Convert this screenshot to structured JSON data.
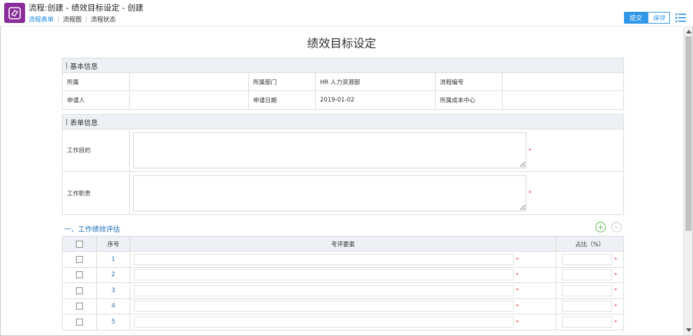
{
  "header": {
    "title": "流程:创建 - 绩效目标设定 - 创建",
    "tabs": [
      {
        "label": "流程表单",
        "active": true
      },
      {
        "label": "流程图",
        "active": false
      },
      {
        "label": "流程状态",
        "active": false
      }
    ],
    "submit_label": "提交",
    "save_label": "保存",
    "logo_icon": "workflow-logo-icon",
    "menu_icon": "list-menu-icon"
  },
  "colors": {
    "brand": "#8a2d9a",
    "accent": "#2f96e8",
    "required": "#e53935",
    "add": "#5cb85c",
    "section_bg": "#edf0f4"
  },
  "page_title": "绩效目标设定",
  "basic_info": {
    "section_title": "基本信息",
    "rows": [
      [
        {
          "label": "所属",
          "value": ""
        },
        {
          "label": "所属部门",
          "value": "HR 人力资源部"
        },
        {
          "label": "流程编号",
          "value": ""
        }
      ],
      [
        {
          "label": "申请人",
          "value": ""
        },
        {
          "label": "申请日期",
          "value": "2019-01-02"
        },
        {
          "label": "所属成本中心",
          "value": ""
        }
      ]
    ]
  },
  "form_info": {
    "section_title": "表单信息",
    "fields": [
      {
        "label": "工作目的",
        "value": "",
        "required": true
      },
      {
        "label": "工作职责",
        "value": "",
        "required": true
      }
    ]
  },
  "evaluation": {
    "title": "一、工作绩效评估",
    "add_label": "+",
    "remove_label": "−",
    "columns": [
      "",
      "序号",
      "考评要素",
      "占比（%）"
    ],
    "rows": [
      {
        "seq": "1",
        "factor": "",
        "ratio": ""
      },
      {
        "seq": "2",
        "factor": "",
        "ratio": ""
      },
      {
        "seq": "3",
        "factor": "",
        "ratio": ""
      },
      {
        "seq": "4",
        "factor": "",
        "ratio": ""
      },
      {
        "seq": "5",
        "factor": "",
        "ratio": ""
      }
    ],
    "required_mark": "*"
  }
}
